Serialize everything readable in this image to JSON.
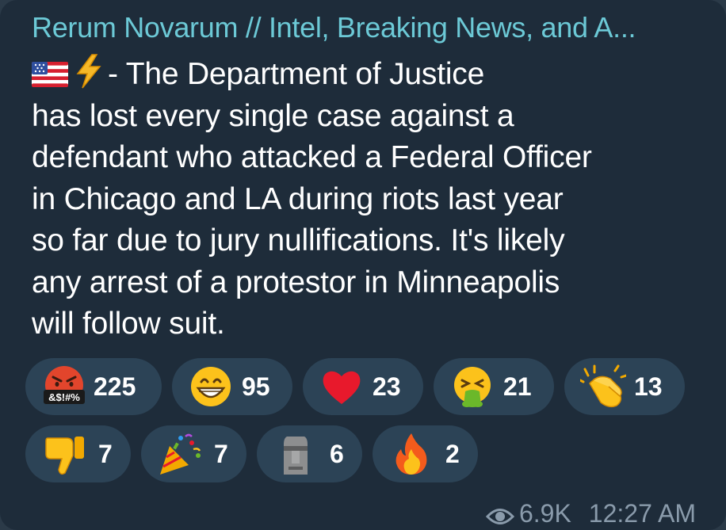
{
  "channel": {
    "name": "Rerum Novarum // Intel, Breaking News, and A..."
  },
  "message": {
    "flag_icon": "us-flag-emoji",
    "zap_icon": "high-voltage-emoji",
    "lines": [
      "- The Department of Justice",
      "has lost every single case against a",
      "defendant who attacked a Federal Officer",
      "in Chicago and LA during riots last year",
      "so far due to jury nullifications. It's likely",
      "any arrest of a protestor in Minneapolis",
      "will follow suit."
    ]
  },
  "reactions": [
    {
      "emoji": "face-with-symbols-on-mouth-emoji",
      "symbol_text": "&$!#%",
      "count": "225"
    },
    {
      "emoji": "grinning-face-emoji",
      "count": "95"
    },
    {
      "emoji": "red-heart-emoji",
      "count": "23"
    },
    {
      "emoji": "face-vomiting-emoji",
      "count": "21"
    },
    {
      "emoji": "clapping-hands-emoji",
      "count": "13"
    },
    {
      "emoji": "thumbs-down-emoji",
      "count": "7"
    },
    {
      "emoji": "party-popper-emoji",
      "count": "7"
    },
    {
      "emoji": "moai-emoji",
      "count": "6"
    },
    {
      "emoji": "fire-emoji",
      "count": "2"
    }
  ],
  "footer": {
    "views_icon": "eye-icon",
    "views": "6.9K",
    "time": "12:27 AM"
  },
  "colors": {
    "bubble": "#1e2c3a",
    "channel_name": "#6cc9d6",
    "reaction_pill": "#2c4356",
    "footer_text": "#8a9bab"
  }
}
